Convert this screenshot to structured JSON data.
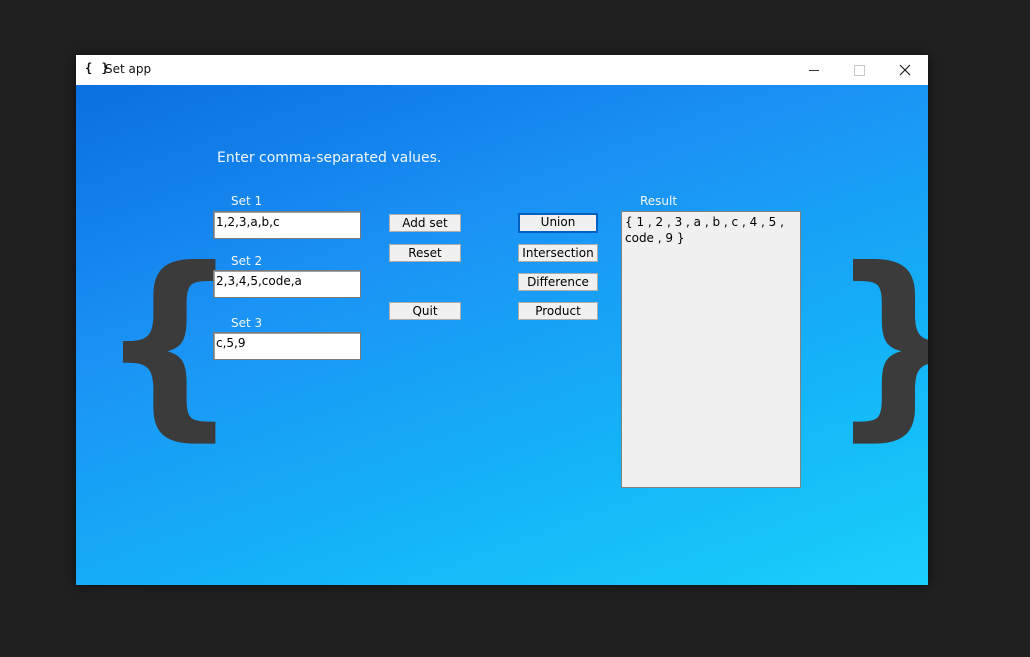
{
  "window": {
    "icon_text": "{ }",
    "title": "Set app"
  },
  "form": {
    "instruction": "Enter comma-separated values.",
    "set1_label": "Set 1",
    "set1_value": "1,2,3,a,b,c",
    "set2_label": "Set 2",
    "set2_value": "2,3,4,5,code,a",
    "set3_label": "Set 3",
    "set3_value": "c,5,9"
  },
  "buttons": {
    "add_set": "Add set",
    "reset": "Reset",
    "quit": "Quit",
    "union": "Union",
    "intersection": "Intersection",
    "difference": "Difference",
    "product": "Product"
  },
  "result": {
    "label": "Result",
    "text": "{ 1 , 2 , 3 , a , b , c , 4 , 5 , code , 9 }"
  },
  "decor": {
    "left_brace": "{",
    "right_brace": "}"
  },
  "colors": {
    "background_gradient_start": "#0a6fe0",
    "background_gradient_end": "#1ad0fc",
    "brace_color": "#3b3b3b"
  }
}
